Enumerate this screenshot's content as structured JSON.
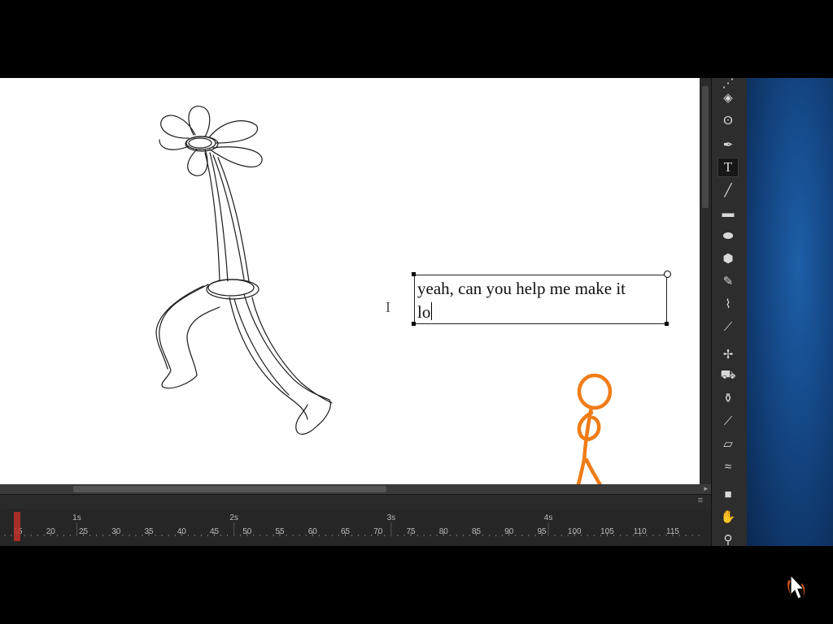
{
  "canvas": {
    "text_box": {
      "line1": "yeah, can you help me make it",
      "line2": "lo"
    }
  },
  "timeline": {
    "seconds": [
      "1s",
      "2s",
      "3s",
      "4s"
    ],
    "frames": [
      "15",
      "20",
      "25",
      "30",
      "35",
      "40",
      "45",
      "50",
      "55",
      "60",
      "65",
      "70",
      "75",
      "80",
      "85",
      "90",
      "95",
      "100",
      "105",
      "110",
      "115"
    ],
    "playhead_frame": 15
  },
  "toolbar": {
    "tools": [
      "subselection-icon",
      "transform-icon",
      "lasso-icon",
      "pen-icon",
      "text-icon",
      "line-icon",
      "rectangle-icon",
      "oval-icon",
      "polystar-icon",
      "pencil-icon",
      "paintbrush-icon",
      "brush-icon",
      "bone-icon",
      "paint-bucket-icon",
      "ink-bottle-icon",
      "eyedropper-icon",
      "eraser-icon",
      "width-icon",
      "camera-icon",
      "hand-icon",
      "zoom-icon"
    ],
    "active_tool": "text-icon"
  },
  "colors": {
    "stick_figure": "#f07c17",
    "stage_bg": "#ffffff",
    "ui_bg": "#1f1f1f",
    "playhead": "#c0302a"
  }
}
